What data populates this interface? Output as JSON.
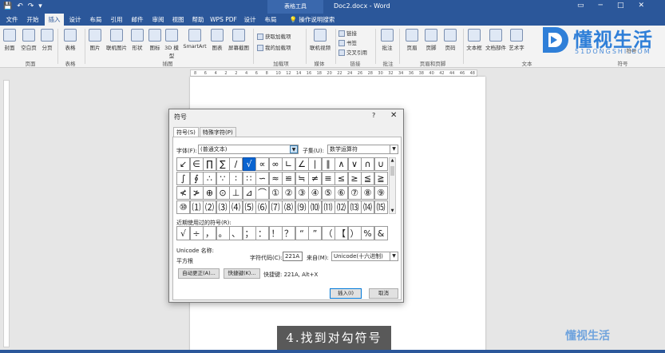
{
  "window": {
    "context_tab": "表格工具",
    "doc_title": "Doc2.docx  -  Word",
    "controls": [
      "▭",
      "─",
      "□",
      "✕"
    ]
  },
  "tabs": [
    "文件",
    "开始",
    "插入",
    "设计",
    "布局",
    "引用",
    "邮件",
    "审阅",
    "视图",
    "帮助",
    "WPS PDF",
    "设计",
    "布局",
    "操作说明搜索"
  ],
  "ribbon": {
    "buttons": [
      "封面",
      "空白页",
      "分页",
      "表格",
      "图片",
      "联机图片",
      "形状",
      "图标",
      "3D 模型",
      "SmartArt",
      "图表",
      "屏幕截图",
      "联机视频",
      "批注",
      "页眉",
      "页脚",
      "页码",
      "文本框",
      "文档部件",
      "艺术字",
      "符号"
    ],
    "small": [
      "获取加载项",
      "我的加载项",
      "链接",
      "书签",
      "交叉引用"
    ],
    "groups": [
      "页面",
      "表格",
      "插图",
      "加载项",
      "媒体",
      "链接",
      "批注",
      "页眉和页脚",
      "文本",
      "符号"
    ]
  },
  "logo": {
    "text": "懂视生活",
    "sub": "51DONGSHI.COM"
  },
  "ruler": [
    "8",
    "6",
    "4",
    "2",
    "2",
    "4",
    "6",
    "8",
    "10",
    "12",
    "14",
    "16",
    "18",
    "20",
    "22",
    "24",
    "26",
    "28",
    "30",
    "32",
    "34",
    "36",
    "38",
    "40",
    "42",
    "44",
    "46",
    "48"
  ],
  "dialog": {
    "title": "符号",
    "help": "?",
    "close": "✕",
    "tab_symbols": "符号(S)",
    "tab_special": "特殊字符(P)",
    "font_label": "字体(F):",
    "font_value": "(普通文本)",
    "subset_label": "子集(U):",
    "subset_value": "数学运算符",
    "grid": [
      [
        "↙",
        "∈",
        "∏",
        "∑",
        "∕",
        "√",
        "∝",
        "∞",
        "∟",
        "∠",
        "∣",
        "∥",
        "∧",
        "∨",
        "∩",
        "∪"
      ],
      [
        "∫",
        "∮",
        "∴",
        "∵",
        "∶",
        "∷",
        "∽",
        "≈",
        "≌",
        "≒",
        "≠",
        "≡",
        "≤",
        "≥",
        "≦",
        "≧"
      ],
      [
        "≮",
        "≯",
        "⊕",
        "⊙",
        "⊥",
        "⊿",
        "⌒",
        "①",
        "②",
        "③",
        "④",
        "⑤",
        "⑥",
        "⑦",
        "⑧",
        "⑨"
      ],
      [
        "⑩",
        "⑴",
        "⑵",
        "⑶",
        "⑷",
        "⑸",
        "⑹",
        "⑺",
        "⑻",
        "⑼",
        "⑽",
        "⑾",
        "⑿",
        "⒀",
        "⒁",
        "⒂"
      ]
    ],
    "selected_index": 5,
    "recent_label": "近期使用过的符号(R):",
    "recent": [
      "√",
      "÷",
      "，",
      "。",
      "、",
      "；",
      "：",
      "！",
      "？",
      "“",
      "”",
      "（",
      "【",
      "）",
      "%",
      "&"
    ],
    "unicode_label": "Unicode 名称:",
    "unicode_name": "平方根",
    "code_label": "字符代码(C):",
    "code_value": "221A",
    "from_label": "来自(M):",
    "from_value": "Unicode(十六进制)",
    "autocorrect_button": "自动更正(A)...",
    "shortcut_button": "快捷键(K)...",
    "shortcut_text": "快捷键: 221A, Alt+X",
    "insert_button": "插入(I)",
    "cancel_button": "取消"
  },
  "caption": "4.找到对勾符号",
  "watermark2": "懂视生活"
}
